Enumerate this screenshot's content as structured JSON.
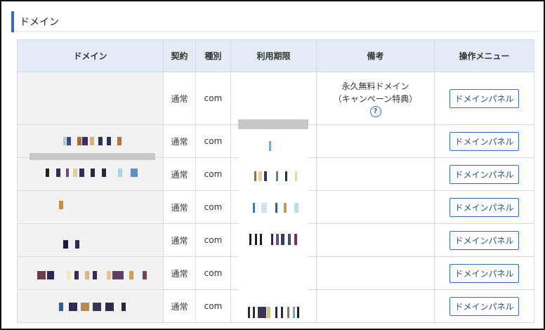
{
  "section": {
    "title": "ドメイン"
  },
  "table": {
    "headers": [
      "ドメイン",
      "契約",
      "種別",
      "利用期限",
      "備考",
      "操作メニュー"
    ],
    "rows": [
      {
        "contract": "通常",
        "type": "com",
        "note_line1": "永久無料ドメイン",
        "note_line2": "（キャンペーン特典）",
        "help": "?",
        "action": "ドメインパネル"
      },
      {
        "contract": "通常",
        "type": "com",
        "action": "ドメインパネル"
      },
      {
        "contract": "通常",
        "type": "com",
        "action": "ドメインパネル"
      },
      {
        "contract": "通常",
        "type": "com",
        "action": "ドメインパネル"
      },
      {
        "contract": "通常",
        "type": "com",
        "action": "ドメインパネル"
      },
      {
        "contract": "通常",
        "type": "com",
        "action": "ドメインパネル"
      },
      {
        "contract": "通常",
        "type": "com",
        "action": "ドメインパネル"
      }
    ]
  },
  "colors": {
    "accent": "#2f6db5",
    "header_bg": "#e3ecf6",
    "domain_bg": "#f2f2f2"
  }
}
